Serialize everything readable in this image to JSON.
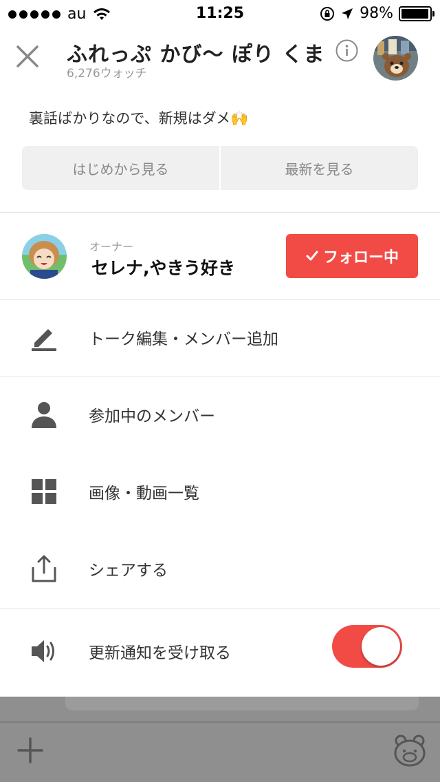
{
  "status_bar": {
    "carrier": "au",
    "time": "11:25",
    "battery_percent": "98%",
    "battery_level": 0.98
  },
  "header": {
    "title": "ふれっぷ かび〜 ぽり くま",
    "watch_count": "6,276ウォッチ"
  },
  "description": "裏話ばかりなので、新規はダメ🙌",
  "view_buttons": {
    "from_start": "はじめから見る",
    "latest": "最新を見る"
  },
  "owner": {
    "label": "オーナー",
    "name": "セレナ,やきう好き",
    "follow_label": "フォロー中"
  },
  "menu": {
    "edit": "トーク編集・メンバー追加",
    "members": "参加中のメンバー",
    "media": "画像・動画一覧",
    "share": "シェアする",
    "notify": "更新通知を受け取る"
  },
  "notify_enabled": true,
  "colors": {
    "accent": "#f24b45",
    "icon": "#555555"
  }
}
